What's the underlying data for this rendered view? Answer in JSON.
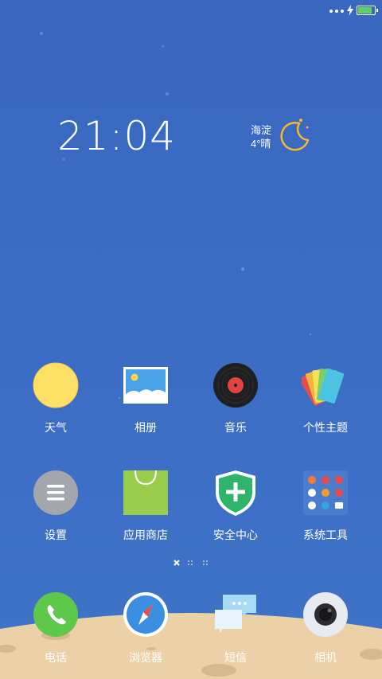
{
  "status_bar": {
    "battery_level": 0.95,
    "battery_color": "#5fd15f",
    "icons": [
      "more-dots-icon",
      "charging-bolt-icon",
      "battery-icon"
    ]
  },
  "lockscreen_widget": {
    "time": "21:04",
    "location": "海淀",
    "weather": "4°晴",
    "weather_icon": "crescent-moon-icon"
  },
  "apps_row1": [
    {
      "label": "天气",
      "icon": "sun-icon"
    },
    {
      "label": "相册",
      "icon": "photo-album-icon"
    },
    {
      "label": "音乐",
      "icon": "vinyl-record-icon"
    },
    {
      "label": "个性主题",
      "icon": "theme-cards-icon"
    }
  ],
  "apps_row2": [
    {
      "label": "设置",
      "icon": "settings-menu-icon"
    },
    {
      "label": "应用商店",
      "icon": "shopping-bag-icon"
    },
    {
      "label": "安全中心",
      "icon": "security-shield-icon"
    },
    {
      "label": "系统工具",
      "icon": "folder-grid-icon"
    }
  ],
  "page_indicator": {
    "pages": 3,
    "current": 1
  },
  "dock": [
    {
      "label": "电话",
      "icon": "phone-icon"
    },
    {
      "label": "浏览器",
      "icon": "compass-icon"
    },
    {
      "label": "短信",
      "icon": "message-bubbles-icon"
    },
    {
      "label": "相机",
      "icon": "camera-icon"
    }
  ],
  "colors": {
    "wallpaper": "#3b6dc4",
    "ground": "#ecd0a8",
    "sun": "#ffe066",
    "moon": "#f5b731",
    "store_bag": "#9acd4e",
    "shield": "#2fb36d",
    "phone": "#5dc84a",
    "browser": "#3a8fe0"
  }
}
